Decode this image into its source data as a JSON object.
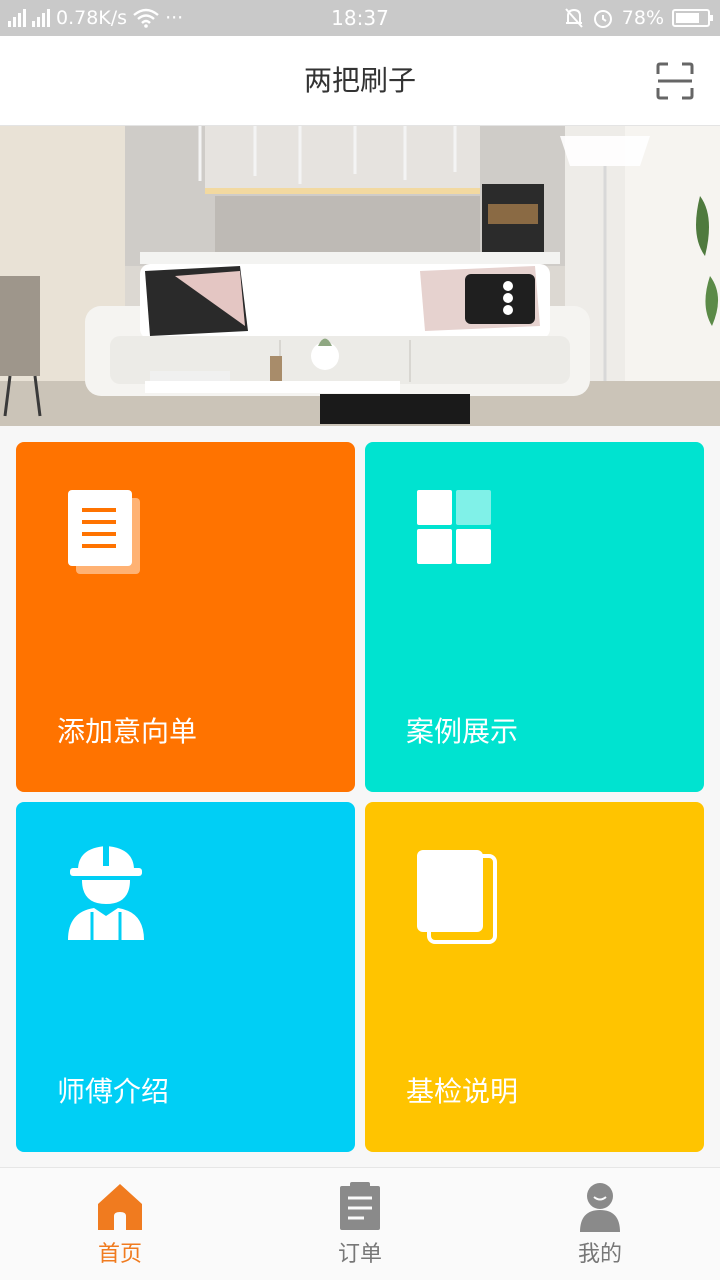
{
  "status_bar": {
    "network_speed": "0.78K/s",
    "dots": "···",
    "time": "18:37",
    "battery": "78%",
    "battery_level": 0.78,
    "net_tags": [
      "4G",
      "2G"
    ]
  },
  "header": {
    "title": "两把刷子",
    "scan_icon": "scan-icon"
  },
  "banner": {
    "alt": "living-room-banner"
  },
  "tiles": [
    {
      "label": "添加意向单",
      "icon": "document-icon",
      "color": "#ff7300"
    },
    {
      "label": "案例展示",
      "icon": "grid-icon",
      "color": "#00e3d0"
    },
    {
      "label": "师傅介绍",
      "icon": "worker-icon",
      "color": "#00cff5"
    },
    {
      "label": "基检说明",
      "icon": "book-icon",
      "color": "#ffc400"
    }
  ],
  "tabbar": {
    "items": [
      {
        "label": "首页",
        "icon": "home-icon",
        "active": true
      },
      {
        "label": "订单",
        "icon": "order-icon",
        "active": false
      },
      {
        "label": "我的",
        "icon": "profile-icon",
        "active": false
      }
    ],
    "active_color": "#f07b1f",
    "inactive_color": "#8a8a8a"
  }
}
